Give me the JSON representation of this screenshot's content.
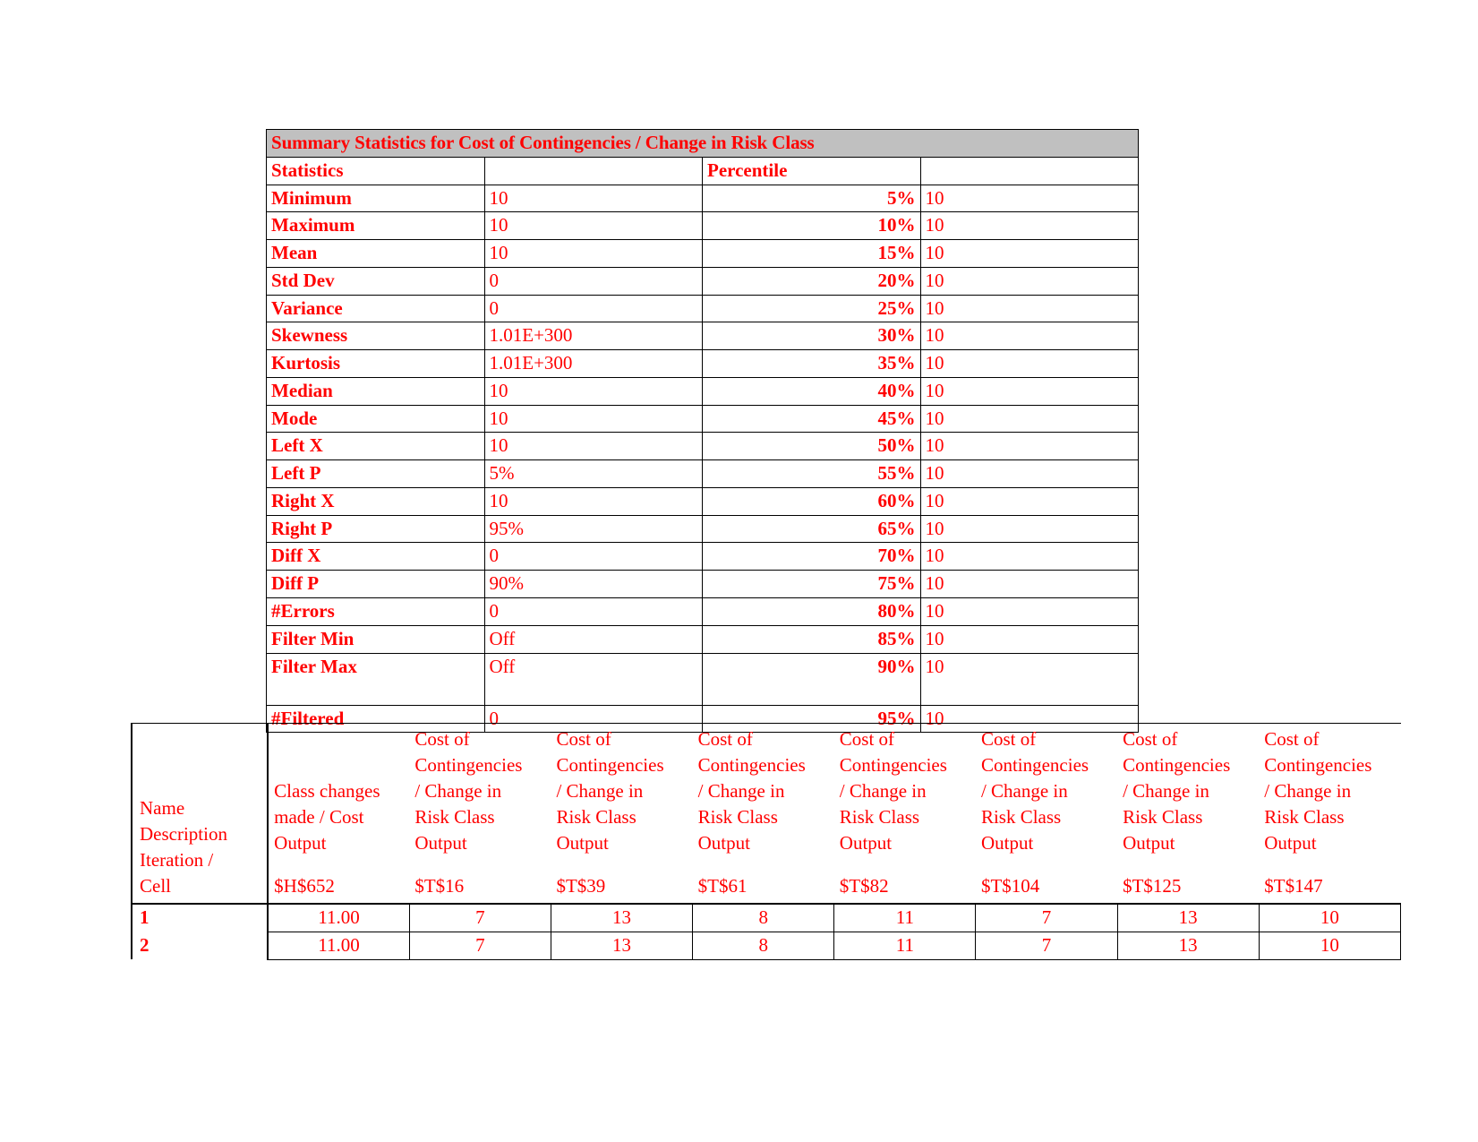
{
  "summary_table": {
    "title": "Summary Statistics for Cost of Contingencies / Change in Risk Class",
    "header": {
      "statistics_label": "Statistics",
      "blank_label": "",
      "percentile_label": "Percentile",
      "percentile_value_label": ""
    },
    "rows": [
      {
        "stat": "Minimum",
        "value": "10",
        "percentile": "5%",
        "pvalue": "10"
      },
      {
        "stat": "Maximum",
        "value": "10",
        "percentile": "10%",
        "pvalue": "10"
      },
      {
        "stat": "Mean",
        "value": "10",
        "percentile": "15%",
        "pvalue": "10"
      },
      {
        "stat": "Std Dev",
        "value": "0",
        "percentile": "20%",
        "pvalue": "10"
      },
      {
        "stat": "Variance",
        "value": "0",
        "percentile": "25%",
        "pvalue": "10"
      },
      {
        "stat": "Skewness",
        "value": "1.01E+300",
        "percentile": "30%",
        "pvalue": "10"
      },
      {
        "stat": "Kurtosis",
        "value": "1.01E+300",
        "percentile": "35%",
        "pvalue": "10"
      },
      {
        "stat": "Median",
        "value": "10",
        "percentile": "40%",
        "pvalue": "10"
      },
      {
        "stat": "Mode",
        "value": "10",
        "percentile": "45%",
        "pvalue": "10"
      },
      {
        "stat": "Left X",
        "value": "10",
        "percentile": "50%",
        "pvalue": "10"
      },
      {
        "stat": "Left P",
        "value": "5%",
        "percentile": "55%",
        "pvalue": "10"
      },
      {
        "stat": "Right X",
        "value": "10",
        "percentile": "60%",
        "pvalue": "10"
      },
      {
        "stat": "Right P",
        "value": "95%",
        "percentile": "65%",
        "pvalue": "10"
      },
      {
        "stat": "Diff X",
        "value": "0",
        "percentile": "70%",
        "pvalue": "10"
      },
      {
        "stat": "Diff P",
        "value": "90%",
        "percentile": "75%",
        "pvalue": "10"
      },
      {
        "stat": "#Errors",
        "value": "0",
        "percentile": "80%",
        "pvalue": "10"
      },
      {
        "stat": "Filter Min",
        "value": "Off",
        "percentile": "85%",
        "pvalue": "10"
      },
      {
        "stat": "Filter Max",
        "value": "Off",
        "percentile": "90%",
        "pvalue": "10"
      },
      {
        "stat": "#Filtered",
        "value": "0",
        "percentile": "95%",
        "pvalue": "10"
      }
    ]
  },
  "detail_table": {
    "corner": {
      "name": "Name",
      "description": "Description",
      "iteration": "Iteration /",
      "cell": "Cell"
    },
    "columns": [
      {
        "name": "Class changes",
        "description": "made / Cost",
        "extra": "",
        "output": "Output",
        "cell": "$H$652"
      },
      {
        "name": "Cost of",
        "description": "Contingencies",
        "extra": "/ Change in",
        "line4": "Risk Class",
        "output": "Output",
        "cell": "$T$16"
      },
      {
        "name": "Cost of",
        "description": "Contingencies",
        "extra": "/ Change in",
        "line4": "Risk Class",
        "output": "Output",
        "cell": "$T$39"
      },
      {
        "name": "Cost of",
        "description": "Contingencies",
        "extra": "/ Change in",
        "line4": "Risk Class",
        "output": "Output",
        "cell": "$T$61"
      },
      {
        "name": "Cost of",
        "description": "Contingencies",
        "extra": "/ Change in",
        "line4": "Risk Class",
        "output": "Output",
        "cell": "$T$82"
      },
      {
        "name": "Cost of",
        "description": "Contingencies",
        "extra": "/ Change in",
        "line4": "Risk Class",
        "output": "Output",
        "cell": "$T$104"
      },
      {
        "name": "Cost of",
        "description": "Contingencies",
        "extra": "/ Change in",
        "line4": "Risk Class",
        "output": "Output",
        "cell": "$T$125"
      },
      {
        "name": "Cost of",
        "description": "Contingencies",
        "extra": "/ Change in",
        "line4": "Risk Class",
        "output": "Output",
        "cell": "$T$147"
      }
    ],
    "rows": [
      {
        "index": "1",
        "values": [
          "11.00",
          "7",
          "13",
          "8",
          "11",
          "7",
          "13",
          "10"
        ]
      },
      {
        "index": "2",
        "values": [
          "11.00",
          "7",
          "13",
          "8",
          "11",
          "7",
          "13",
          "10"
        ]
      }
    ]
  },
  "colors": {
    "text_red": "#ff0000",
    "banner_gray": "#c0c0c0",
    "border_black": "#000000",
    "page_background": "#ffffff"
  }
}
